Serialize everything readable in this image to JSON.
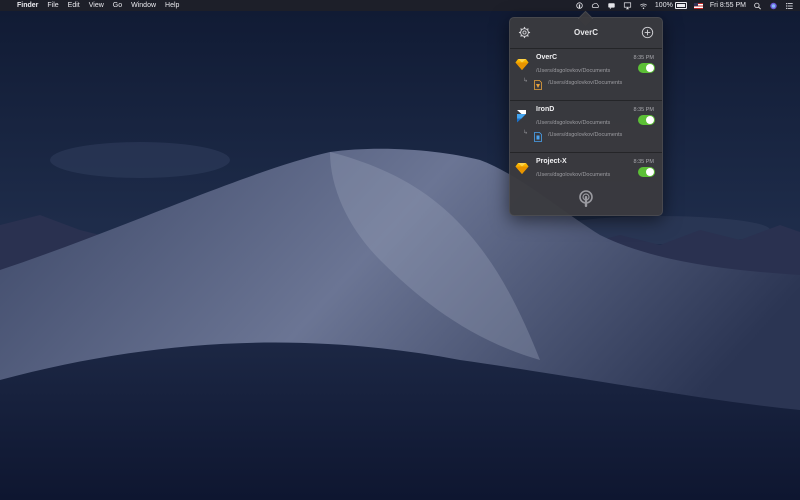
{
  "menubar": {
    "app_name": "Finder",
    "menus": [
      "File",
      "Edit",
      "View",
      "Go",
      "Window",
      "Help"
    ],
    "battery": "100%",
    "clock": "Fri 8:55 PM"
  },
  "popover": {
    "title": "OverC",
    "entries": [
      {
        "name": "OverC",
        "time": "8:35 PM",
        "path": "/Users/dsgolovkov/Documents",
        "sub_path": "/Users/dsgolovkov/Documents",
        "icon": "sketch-icon",
        "enabled": true
      },
      {
        "name": "IronD",
        "time": "8:35 PM",
        "path": "/Users/dsgolovkov/Documents",
        "sub_path": "/Users/dsgolovkov/Documents",
        "icon": "framer-icon",
        "enabled": true
      },
      {
        "name": "Project-X",
        "time": "8:35 PM",
        "path": "/Users/dsgolovkov/Documents",
        "icon": "sketch-icon",
        "enabled": true
      }
    ]
  },
  "colors": {
    "toggle_on": "#5cc036",
    "popover_bg": "#3a3a3e",
    "sketch_orange": "#f7b500"
  }
}
